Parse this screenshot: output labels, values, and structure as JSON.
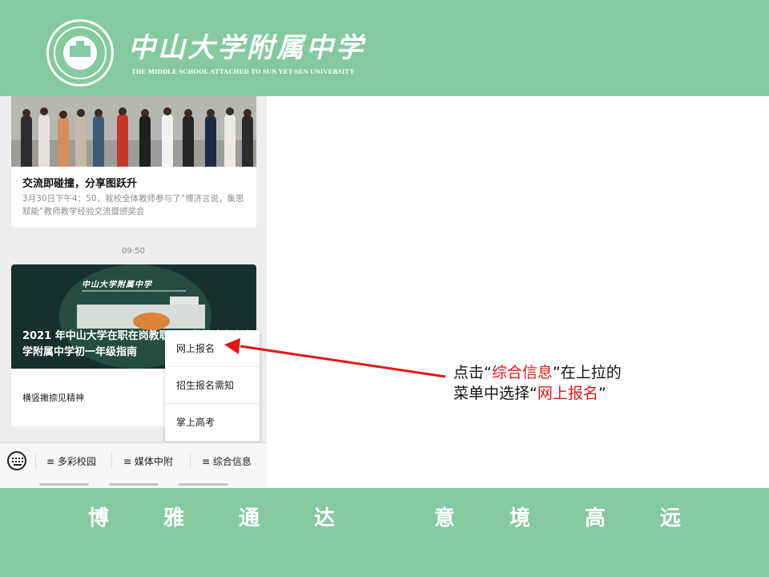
{
  "header": {
    "school_cn": "中山大学附属中学",
    "school_en": "THE MIDDLE SCHOOL ATTACHED TO  SUN YET-SEN UNIVERSITY",
    "brand_color": "#85c9a0"
  },
  "feed": {
    "article1": {
      "title": "交流即碰撞，分享图跃升",
      "desc": "3月30日下午4：50，我校全体教师参与了“博济言说，集思赋能”教师教学经验交流暨颁奖会"
    },
    "timestamp": "09:50",
    "article2": {
      "banner_school": "中山大学附属中学",
      "caption": "2021 年中山大学在职在岗教职工子女就读中山大学附属中学初一年级指南",
      "source": "横竖撇捺见精神"
    }
  },
  "popup_menu": {
    "items": [
      "网上报名",
      "招生报名需知",
      "掌上高考"
    ]
  },
  "menubar": {
    "keyboard_icon": "keyboard-icon",
    "tabs": [
      "≡ 多彩校园",
      "≡ 媒体中附",
      "≡ 综合信息"
    ]
  },
  "annotation": {
    "line1_prefix": "点击“",
    "line1_highlight": "综合信息",
    "line1_suffix": "”在上拉的",
    "line2_prefix": "菜单中选择“",
    "line2_highlight": "网上报名",
    "line2_suffix": "”",
    "arrow_color": "#e01818"
  },
  "footer": {
    "motto": [
      "博",
      "雅",
      "通",
      "达",
      "意",
      "境",
      "高",
      "远"
    ]
  }
}
